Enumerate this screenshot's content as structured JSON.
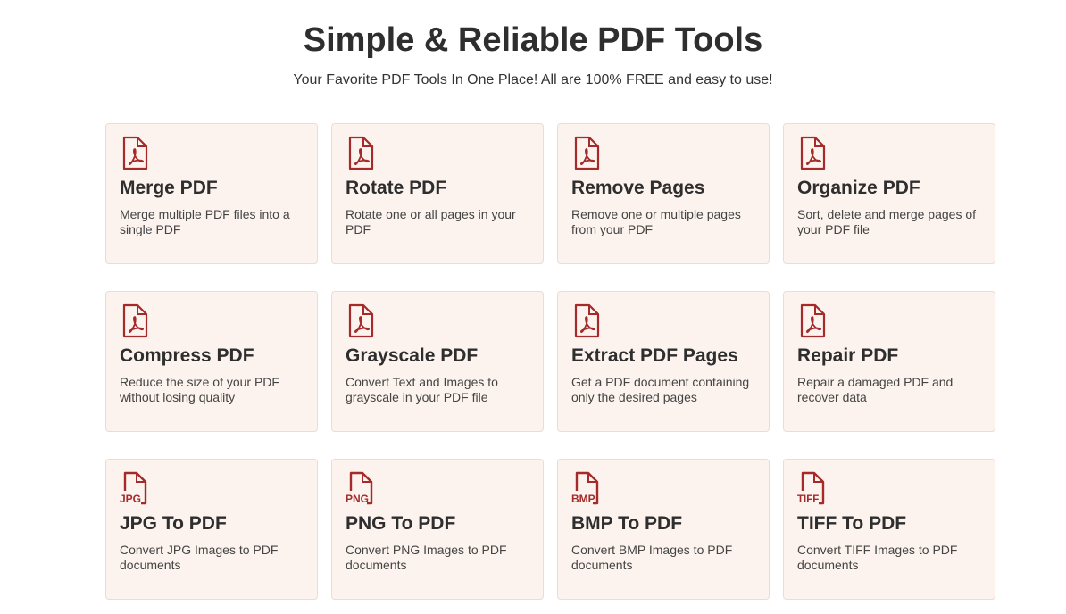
{
  "header": {
    "title": "Simple & Reliable PDF Tools",
    "subtitle": "Your Favorite PDF Tools In One Place! All are 100% FREE and easy to use!"
  },
  "colors": {
    "accent": "#a52a2a",
    "card_bg": "#fcf3ee",
    "card_border": "#ecdcd5"
  },
  "tools": [
    {
      "name": "merge-pdf-card",
      "icon": "pdf-file-icon",
      "badge": "",
      "title": "Merge PDF",
      "desc": "Merge multiple PDF files into a single PDF"
    },
    {
      "name": "rotate-pdf-card",
      "icon": "pdf-file-icon",
      "badge": "",
      "title": "Rotate PDF",
      "desc": "Rotate one or all pages in your PDF"
    },
    {
      "name": "remove-pages-card",
      "icon": "pdf-file-icon",
      "badge": "",
      "title": "Remove Pages",
      "desc": "Remove one or multiple pages from your PDF"
    },
    {
      "name": "organize-pdf-card",
      "icon": "pdf-file-icon",
      "badge": "",
      "title": "Organize PDF",
      "desc": "Sort, delete and merge pages of your PDF file"
    },
    {
      "name": "compress-pdf-card",
      "icon": "pdf-file-icon",
      "badge": "",
      "title": "Compress PDF",
      "desc": "Reduce the size of your PDF without losing quality"
    },
    {
      "name": "grayscale-pdf-card",
      "icon": "pdf-file-icon",
      "badge": "",
      "title": "Grayscale PDF",
      "desc": "Convert Text and Images to grayscale in your PDF file"
    },
    {
      "name": "extract-pdf-pages-card",
      "icon": "pdf-file-icon",
      "badge": "",
      "title": "Extract PDF Pages",
      "desc": "Get a PDF document containing only the desired pages"
    },
    {
      "name": "repair-pdf-card",
      "icon": "pdf-file-icon",
      "badge": "",
      "title": "Repair PDF",
      "desc": "Repair a damaged PDF and recover data"
    },
    {
      "name": "jpg-to-pdf-card",
      "icon": "jpg-file-icon",
      "badge": "JPG",
      "title": "JPG To PDF",
      "desc": "Convert JPG Images to PDF documents"
    },
    {
      "name": "png-to-pdf-card",
      "icon": "png-file-icon",
      "badge": "PNG",
      "title": "PNG To PDF",
      "desc": "Convert PNG Images to PDF documents"
    },
    {
      "name": "bmp-to-pdf-card",
      "icon": "bmp-file-icon",
      "badge": "BMP",
      "title": "BMP To PDF",
      "desc": "Convert BMP Images to PDF documents"
    },
    {
      "name": "tiff-to-pdf-card",
      "icon": "tiff-file-icon",
      "badge": "TIFF",
      "title": "TIFF To PDF",
      "desc": "Convert TIFF Images to PDF documents"
    }
  ]
}
